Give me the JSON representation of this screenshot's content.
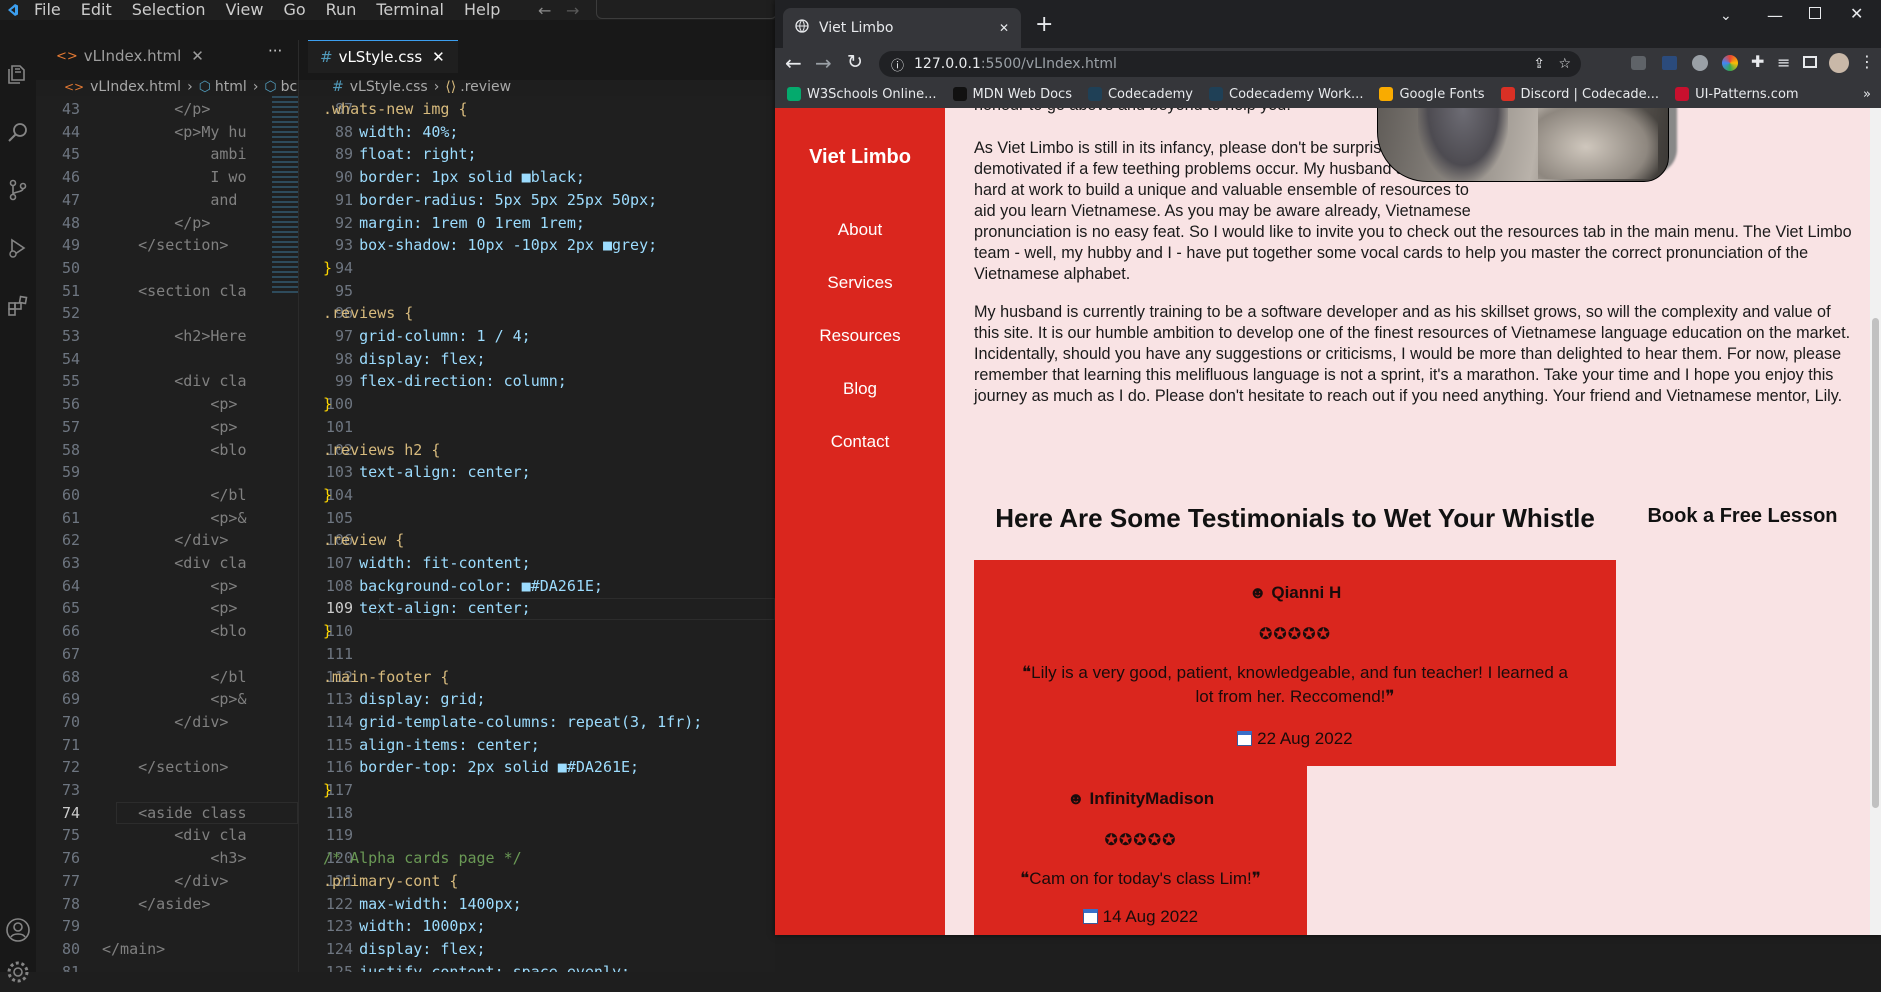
{
  "vscode": {
    "menu": [
      "File",
      "Edit",
      "Selection",
      "View",
      "Go",
      "Run",
      "Terminal",
      "Help"
    ],
    "tabs": [
      {
        "icon": "<>",
        "label": "vLIndex.html"
      },
      {
        "icon": "#",
        "label": "vLStyle.css"
      }
    ],
    "more_label": "···",
    "left_breadcrumb": [
      "vLIndex.html",
      "html",
      "bc"
    ],
    "right_breadcrumb": [
      "vLStyle.css",
      ".review"
    ],
    "left_lines": [
      {
        "n": "43",
        "t": "        </p>"
      },
      {
        "n": "44",
        "t": "        <p>My hu"
      },
      {
        "n": "45",
        "t": "            ambi"
      },
      {
        "n": "46",
        "t": "            I wo"
      },
      {
        "n": "47",
        "t": "            and"
      },
      {
        "n": "48",
        "t": "        </p>"
      },
      {
        "n": "49",
        "t": "    </section>"
      },
      {
        "n": "50",
        "t": ""
      },
      {
        "n": "51",
        "t": "    <section cla"
      },
      {
        "n": "52",
        "t": ""
      },
      {
        "n": "53",
        "t": "        <h2>Here"
      },
      {
        "n": "54",
        "t": ""
      },
      {
        "n": "55",
        "t": "        <div cla"
      },
      {
        "n": "56",
        "t": "            <p>"
      },
      {
        "n": "57",
        "t": "            <p>"
      },
      {
        "n": "58",
        "t": "            <blo"
      },
      {
        "n": "59",
        "t": ""
      },
      {
        "n": "60",
        "t": "            </bl"
      },
      {
        "n": "61",
        "t": "            <p>&"
      },
      {
        "n": "62",
        "t": "        </div>"
      },
      {
        "n": "63",
        "t": "        <div cla"
      },
      {
        "n": "64",
        "t": "            <p>"
      },
      {
        "n": "65",
        "t": "            <p>"
      },
      {
        "n": "66",
        "t": "            <blo"
      },
      {
        "n": "67",
        "t": ""
      },
      {
        "n": "68",
        "t": "            </bl"
      },
      {
        "n": "69",
        "t": "            <p>&"
      },
      {
        "n": "70",
        "t": "        </div>"
      },
      {
        "n": "71",
        "t": ""
      },
      {
        "n": "72",
        "t": "    </section>"
      },
      {
        "n": "73",
        "t": ""
      },
      {
        "n": "74",
        "t": "    <aside class"
      },
      {
        "n": "75",
        "t": "        <div cla"
      },
      {
        "n": "76",
        "t": "            <h3>"
      },
      {
        "n": "77",
        "t": "        </div>"
      },
      {
        "n": "78",
        "t": "    </aside>"
      },
      {
        "n": "79",
        "t": ""
      },
      {
        "n": "80",
        "t": "</main>"
      },
      {
        "n": "81",
        "t": ""
      }
    ],
    "right_lines": [
      {
        "n": "87",
        "t": ".whats-new img {",
        "k": "sel"
      },
      {
        "n": "88",
        "t": "    width: 40%;",
        "k": "decl"
      },
      {
        "n": "89",
        "t": "    float: right;",
        "k": "decl"
      },
      {
        "n": "90",
        "t": "    border: 1px solid ■black;",
        "k": "decl"
      },
      {
        "n": "91",
        "t": "    border-radius: 5px 5px 25px 50px;",
        "k": "decl"
      },
      {
        "n": "92",
        "t": "    margin: 1rem 0 1rem 1rem;",
        "k": "decl"
      },
      {
        "n": "93",
        "t": "    box-shadow: 10px -10px 2px ■grey;",
        "k": "decl"
      },
      {
        "n": "94",
        "t": "}",
        "k": "brace"
      },
      {
        "n": "95",
        "t": "",
        "k": ""
      },
      {
        "n": "96",
        "t": ".reviews {",
        "k": "sel"
      },
      {
        "n": "97",
        "t": "    grid-column: 1 / 4;",
        "k": "decl"
      },
      {
        "n": "98",
        "t": "    display: flex;",
        "k": "decl"
      },
      {
        "n": "99",
        "t": "    flex-direction: column;",
        "k": "decl"
      },
      {
        "n": "100",
        "t": "}",
        "k": "brace"
      },
      {
        "n": "101",
        "t": "",
        "k": ""
      },
      {
        "n": "102",
        "t": ".reviews h2 {",
        "k": "sel"
      },
      {
        "n": "103",
        "t": "    text-align: center;",
        "k": "decl"
      },
      {
        "n": "104",
        "t": "}",
        "k": "brace"
      },
      {
        "n": "105",
        "t": "",
        "k": ""
      },
      {
        "n": "106",
        "t": ".review {",
        "k": "sel"
      },
      {
        "n": "107",
        "t": "    width: fit-content;",
        "k": "decl"
      },
      {
        "n": "108",
        "t": "    background-color: ■#DA261E;",
        "k": "decl"
      },
      {
        "n": "109",
        "t": "    text-align: center;",
        "k": "decl"
      },
      {
        "n": "110",
        "t": "}",
        "k": "brace"
      },
      {
        "n": "111",
        "t": "",
        "k": ""
      },
      {
        "n": "112",
        "t": ".main-footer {",
        "k": "sel"
      },
      {
        "n": "113",
        "t": "    display: grid;",
        "k": "decl"
      },
      {
        "n": "114",
        "t": "    grid-template-columns: repeat(3, 1fr);",
        "k": "decl"
      },
      {
        "n": "115",
        "t": "    align-items: center;",
        "k": "decl"
      },
      {
        "n": "116",
        "t": "    border-top: 2px solid ■#DA261E;",
        "k": "decl"
      },
      {
        "n": "117",
        "t": "}",
        "k": "brace"
      },
      {
        "n": "118",
        "t": "",
        "k": ""
      },
      {
        "n": "119",
        "t": "",
        "k": ""
      },
      {
        "n": "120",
        "t": "/* Alpha cards page */",
        "k": "com"
      },
      {
        "n": "121",
        "t": ".primary-cont {",
        "k": "sel"
      },
      {
        "n": "122",
        "t": "    max-width: 1400px;",
        "k": "decl"
      },
      {
        "n": "123",
        "t": "    width: 1000px;",
        "k": "decl"
      },
      {
        "n": "124",
        "t": "    display: flex;",
        "k": "decl"
      },
      {
        "n": "125",
        "t": "    justify-content: space-evenly;",
        "k": "decl"
      }
    ],
    "current_left_line": "74",
    "current_right_line": "109",
    "colors": {
      "editor_bg": "#1f1f1f",
      "accent": "#3c9ff0"
    }
  },
  "browser": {
    "tab_title": "Viet Limbo",
    "new_tab": "+",
    "url_host": "127.0.0.1",
    "url_rest": ":5500/vLIndex.html",
    "bookmarks": [
      {
        "icon": "w3schools-icon",
        "label": "W3Schools Online..."
      },
      {
        "icon": "mdn-icon",
        "label": "MDN Web Docs"
      },
      {
        "icon": "codecademy-icon",
        "label": "Codecademy"
      },
      {
        "icon": "codecademy-icon",
        "label": "Codecademy Work..."
      },
      {
        "icon": "google-fonts-icon",
        "label": "Google Fonts"
      },
      {
        "icon": "discord-icon",
        "label": "Discord | Codecade..."
      },
      {
        "icon": "ui-patterns-icon",
        "label": "UI-Patterns.com"
      }
    ],
    "bookmarks_more": "»"
  },
  "site": {
    "brand": "Viet Limbo",
    "nav": [
      "About",
      "Services",
      "Resources",
      "Blog",
      "Contact"
    ],
    "partial_line": "honour to go above and beyond to help you.",
    "para1": "As Viet Limbo is still in its infancy, please don't be surprised or demotivated if a few teething problems occur. My husband and I are hard at work to build a unique and valuable ensemble of resources to aid you learn Vietnamese. As you may be aware already, Vietnamese pronunciation is no easy feat. So I would like to invite you to check out the resources tab in the main menu. The Viet Limbo team - well, my hubby and I - have put together some vocal cards to help you master the correct pronunciation of the Vietnamese alphabet.",
    "para2": "My husband is currently training to be a software developer and as his skillset grows, so will the complexity and value of this site. It is our humble ambition to develop one of the finest resources of Vietnamese language education on the market. Incidentally, should you have any suggestions or criticisms, I would be more than delighted to hear them. For now, please remember that learning this melifluous language is not a sprint, it's a marathon. Take your time and I hope you enjoy this journey as much as I do. Please don't hesitate to reach out if you need anything. Your friend and Vietnamese mentor, Lily.",
    "testimonials_heading": "Here Are Some Testimonials to Wet Your Whistle",
    "aside_heading": "Book a Free Lesson",
    "reviews": [
      {
        "name": "Qianni H",
        "stars": "✪✪✪✪✪",
        "quote": "❝Lily is a very good, patient, knowledgeable, and fun teacher! I learned a lot from her. Reccomend!❞",
        "date": "22 Aug 2022"
      },
      {
        "name": "InfinityMadison",
        "stars": "✪✪✪✪✪",
        "quote": "❝Cam on for today's class Lim!❞",
        "date": "14 Aug 2022"
      }
    ],
    "user_glyph": "☻",
    "colors": {
      "primary": "#DA261E",
      "background": "#F9E3E4"
    }
  }
}
